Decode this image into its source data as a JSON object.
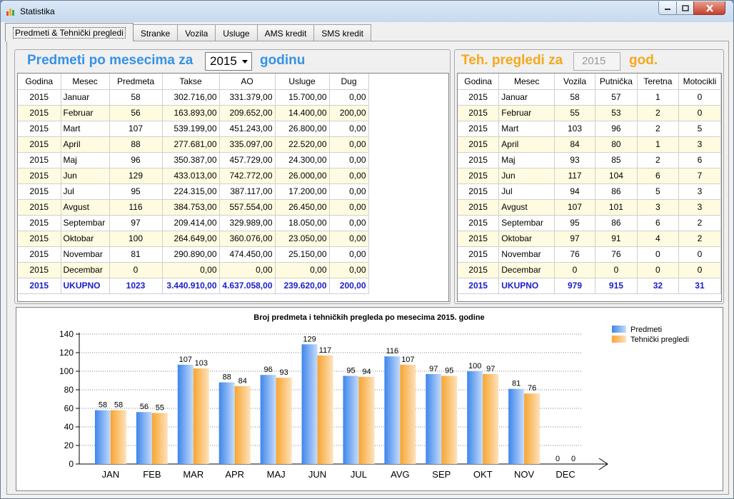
{
  "window": {
    "title": "Statistika",
    "controls": {
      "minimize": "minimize-icon",
      "maximize": "maximize-icon",
      "close": "close-icon"
    }
  },
  "tabs": [
    "Predmeti & Tehnički pregledi",
    "Stranke",
    "Vozila",
    "Usluge",
    "AMS kredit",
    "SMS kredit"
  ],
  "active_tab": 0,
  "left_panel": {
    "title_prefix": "Predmeti po mesecima za",
    "title_suffix": "godinu",
    "year": "2015",
    "columns": [
      "Godina",
      "Mesec",
      "Predmeta",
      "Takse",
      "AO",
      "Usluge",
      "Dug"
    ],
    "rows": [
      [
        "2015",
        "Januar",
        "58",
        "302.716,00",
        "331.379,00",
        "15.700,00",
        "0,00"
      ],
      [
        "2015",
        "Februar",
        "56",
        "163.893,00",
        "209.652,00",
        "14.400,00",
        "200,00"
      ],
      [
        "2015",
        "Mart",
        "107",
        "539.199,00",
        "451.243,00",
        "26.800,00",
        "0,00"
      ],
      [
        "2015",
        "April",
        "88",
        "277.681,00",
        "335.097,00",
        "22.520,00",
        "0,00"
      ],
      [
        "2015",
        "Maj",
        "96",
        "350.387,00",
        "457.729,00",
        "24.300,00",
        "0,00"
      ],
      [
        "2015",
        "Jun",
        "129",
        "433.013,00",
        "742.772,00",
        "26.000,00",
        "0,00"
      ],
      [
        "2015",
        "Jul",
        "95",
        "224.315,00",
        "387.117,00",
        "17.200,00",
        "0,00"
      ],
      [
        "2015",
        "Avgust",
        "116",
        "384.753,00",
        "557.554,00",
        "26.450,00",
        "0,00"
      ],
      [
        "2015",
        "Septembar",
        "97",
        "209.414,00",
        "329.989,00",
        "18.050,00",
        "0,00"
      ],
      [
        "2015",
        "Oktobar",
        "100",
        "264.649,00",
        "360.076,00",
        "23.050,00",
        "0,00"
      ],
      [
        "2015",
        "Novembar",
        "81",
        "290.890,00",
        "474.450,00",
        "25.150,00",
        "0,00"
      ],
      [
        "2015",
        "Decembar",
        "0",
        "0,00",
        "0,00",
        "0,00",
        "0,00"
      ]
    ],
    "total": [
      "2015",
      "UKUPNO",
      "1023",
      "3.440.910,00",
      "4.637.058,00",
      "239.620,00",
      "200,00"
    ]
  },
  "right_panel": {
    "title_prefix": "Teh. pregledi za",
    "title_suffix": "god.",
    "year": "2015",
    "columns": [
      "Godina",
      "Mesec",
      "Vozila",
      "Putnička",
      "Teretna",
      "Motocikli"
    ],
    "rows": [
      [
        "2015",
        "Januar",
        "58",
        "57",
        "1",
        "0"
      ],
      [
        "2015",
        "Februar",
        "55",
        "53",
        "2",
        "0"
      ],
      [
        "2015",
        "Mart",
        "103",
        "96",
        "2",
        "5"
      ],
      [
        "2015",
        "April",
        "84",
        "80",
        "1",
        "3"
      ],
      [
        "2015",
        "Maj",
        "93",
        "85",
        "2",
        "6"
      ],
      [
        "2015",
        "Jun",
        "117",
        "104",
        "6",
        "7"
      ],
      [
        "2015",
        "Jul",
        "94",
        "86",
        "5",
        "3"
      ],
      [
        "2015",
        "Avgust",
        "107",
        "101",
        "3",
        "3"
      ],
      [
        "2015",
        "Septembar",
        "95",
        "86",
        "6",
        "2"
      ],
      [
        "2015",
        "Oktobar",
        "97",
        "91",
        "4",
        "2"
      ],
      [
        "2015",
        "Novembar",
        "76",
        "76",
        "0",
        "0"
      ],
      [
        "2015",
        "Decembar",
        "0",
        "0",
        "0",
        "0"
      ]
    ],
    "total": [
      "2015",
      "UKUPNO",
      "979",
      "915",
      "32",
      "31"
    ]
  },
  "colors": {
    "title_blue": "#3592e6",
    "title_orange": "#f6a81a",
    "row_alt": "#fefbe0",
    "total_text": "#1b20c9",
    "series_predmeti": "#5b9bf0",
    "series_pregledi": "#f9b04a"
  },
  "chart_data": {
    "type": "bar",
    "title": "Broj predmeta i tehničkih pregleda po mesecima 2015. godine",
    "categories": [
      "JAN",
      "FEB",
      "MAR",
      "APR",
      "MAJ",
      "JUN",
      "JUL",
      "AVG",
      "SEP",
      "OKT",
      "NOV",
      "DEC"
    ],
    "series": [
      {
        "name": "Predmeti",
        "values": [
          58,
          56,
          107,
          88,
          96,
          129,
          95,
          116,
          97,
          100,
          81,
          0
        ]
      },
      {
        "name": "Tehnički pregledi",
        "values": [
          58,
          55,
          103,
          84,
          93,
          117,
          94,
          107,
          95,
          97,
          76,
          0
        ]
      }
    ],
    "ylim": [
      0,
      140
    ],
    "yticks": [
      0,
      20,
      40,
      60,
      80,
      100,
      120,
      140
    ],
    "grid": true,
    "legend": "top-right",
    "data_labels": true
  }
}
